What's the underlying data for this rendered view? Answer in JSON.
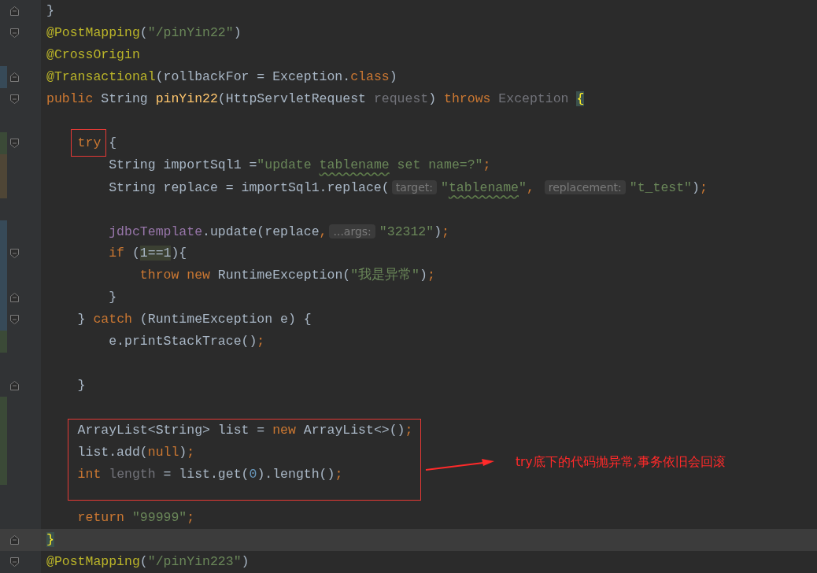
{
  "editor": {
    "lines": [
      {
        "kind": "fold-end",
        "current": false,
        "tokens": [
          {
            "kind": "plain",
            "text": "}"
          }
        ]
      },
      {
        "kind": "fold-start",
        "current": false,
        "tokens": [
          {
            "kind": "annotation",
            "text": "@PostMapping"
          },
          {
            "kind": "plain",
            "text": "("
          },
          {
            "kind": "string",
            "text": "\"/pinYin22\""
          },
          {
            "kind": "plain",
            "text": ")"
          }
        ]
      },
      {
        "kind": "code",
        "current": false,
        "tokens": [
          {
            "kind": "annotation",
            "text": "@CrossOrigin"
          }
        ]
      },
      {
        "kind": "fold-end",
        "color": "#374a58",
        "current": false,
        "tokens": [
          {
            "kind": "annotation",
            "text": "@Transactional"
          },
          {
            "kind": "plain",
            "text": "(rollbackFor = Exception."
          },
          {
            "kind": "keyword",
            "text": "class"
          },
          {
            "kind": "plain",
            "text": ")"
          }
        ]
      },
      {
        "kind": "fold-start",
        "current": false,
        "tokens": [
          {
            "kind": "keyword",
            "text": "public"
          },
          {
            "kind": "plain",
            "text": " String "
          },
          {
            "kind": "method",
            "text": "pinYin22"
          },
          {
            "kind": "plain",
            "text": "(HttpServletRequest "
          },
          {
            "kind": "unused",
            "text": "request"
          },
          {
            "kind": "plain",
            "text": ") "
          },
          {
            "kind": "keyword",
            "text": "throws"
          },
          {
            "kind": "unused",
            "text": " Exception "
          },
          {
            "kind": "brace-match",
            "text": "{"
          }
        ]
      },
      {
        "kind": "code",
        "current": false
      },
      {
        "kind": "fold-start",
        "color": "#3b4a37",
        "current": false,
        "tokens": [
          {
            "kind": "marked-keyword",
            "text": "    try"
          },
          {
            "kind": "plain",
            "text": " {"
          }
        ]
      },
      {
        "kind": "code",
        "color": "#4f4636",
        "current": false,
        "tokens": [
          {
            "kind": "plain",
            "text": "        String importSql1 ="
          },
          {
            "kind": "string",
            "text": "\"update "
          },
          {
            "kind": "typo",
            "text": "tablename"
          },
          {
            "kind": "string",
            "text": " set name=?\""
          },
          {
            "kind": "keyword",
            "text": ";"
          }
        ]
      },
      {
        "kind": "code",
        "color": "#4f4636",
        "current": false,
        "tokens": [
          {
            "kind": "plain",
            "text": "        String replace = importSql1.replace("
          },
          {
            "kind": "hint",
            "text": "target:"
          },
          {
            "kind": "string",
            "text": "\""
          },
          {
            "kind": "typo",
            "text": "tablename"
          },
          {
            "kind": "string",
            "text": "\""
          },
          {
            "kind": "keyword",
            "text": ", "
          },
          {
            "kind": "hint",
            "text": "replacement:"
          },
          {
            "kind": "string",
            "text": "\"t_test\""
          },
          {
            "kind": "plain",
            "text": ")"
          },
          {
            "kind": "keyword",
            "text": ";"
          }
        ]
      },
      {
        "kind": "code",
        "current": false
      },
      {
        "kind": "code",
        "color": "#374a58",
        "current": false,
        "tokens": [
          {
            "kind": "field",
            "text": "        jdbcTemplate"
          },
          {
            "kind": "plain",
            "text": ".update(replace"
          },
          {
            "kind": "keyword",
            "text": ","
          },
          {
            "kind": "hint",
            "text": "...args:"
          },
          {
            "kind": "string",
            "text": "\"32312\""
          },
          {
            "kind": "plain",
            "text": ")"
          },
          {
            "kind": "keyword",
            "text": ";"
          }
        ]
      },
      {
        "kind": "fold-start",
        "color": "#374a58",
        "current": false,
        "tokens": [
          {
            "kind": "keyword",
            "text": "        if"
          },
          {
            "kind": "plain",
            "text": " ("
          },
          {
            "kind": "highlight",
            "text": "1==1"
          },
          {
            "kind": "plain",
            "text": "){"
          }
        ]
      },
      {
        "kind": "code",
        "color": "#374a58",
        "current": false,
        "tokens": [
          {
            "kind": "keyword",
            "text": "            throw new"
          },
          {
            "kind": "plain",
            "text": " RuntimeException("
          },
          {
            "kind": "string",
            "text": "\"我是异常\""
          },
          {
            "kind": "plain",
            "text": ")"
          },
          {
            "kind": "keyword",
            "text": ";"
          }
        ]
      },
      {
        "kind": "fold-end",
        "color": "#374a58",
        "current": false,
        "tokens": [
          {
            "kind": "plain",
            "text": "        }"
          }
        ]
      },
      {
        "kind": "fold-start",
        "color": "#374a58",
        "current": false,
        "tokens": [
          {
            "kind": "plain",
            "text": "    } "
          },
          {
            "kind": "keyword",
            "text": "catch"
          },
          {
            "kind": "plain",
            "text": " (RuntimeException e) {"
          }
        ]
      },
      {
        "kind": "code",
        "color": "#3b4a37",
        "current": false,
        "tokens": [
          {
            "kind": "plain",
            "text": "        e.printStackTrace()"
          },
          {
            "kind": "keyword",
            "text": ";"
          }
        ]
      },
      {
        "kind": "code",
        "current": false
      },
      {
        "kind": "fold-end",
        "current": false,
        "tokens": [
          {
            "kind": "plain",
            "text": "    }"
          }
        ]
      },
      {
        "kind": "code",
        "color": "#3b4a37",
        "current": false
      },
      {
        "kind": "framed-block",
        "note": "try底下的代码抛异常,事务依旧会回滚",
        "lines": [
          {
            "kind": "code",
            "color": "#3b4a37",
            "current": false,
            "tokens": [
              {
                "kind": "plain",
                "text": "    ArrayList<String> list = "
              },
              {
                "kind": "keyword",
                "text": "new"
              },
              {
                "kind": "plain",
                "text": " ArrayList<>()"
              },
              {
                "kind": "keyword",
                "text": ";"
              }
            ]
          },
          {
            "kind": "code",
            "color": "#3b4a37",
            "current": false,
            "tokens": [
              {
                "kind": "plain",
                "text": "    list.add("
              },
              {
                "kind": "keyword",
                "text": "null"
              },
              {
                "kind": "plain",
                "text": ")"
              },
              {
                "kind": "keyword",
                "text": ";"
              }
            ]
          },
          {
            "kind": "code",
            "color": "#3b4a37",
            "current": false,
            "tokens": [
              {
                "kind": "keyword",
                "text": "    int"
              },
              {
                "kind": "unused",
                "text": " length"
              },
              {
                "kind": "plain",
                "text": " = list.get("
              },
              {
                "kind": "number",
                "text": "0"
              },
              {
                "kind": "plain",
                "text": ").length()"
              },
              {
                "kind": "keyword",
                "text": ";"
              }
            ]
          },
          {
            "kind": "code",
            "current": false
          }
        ]
      },
      {
        "kind": "code",
        "current": false,
        "tokens": [
          {
            "kind": "keyword",
            "text": "    return"
          },
          {
            "kind": "string",
            "text": " \"99999\""
          },
          {
            "kind": "keyword",
            "text": ";"
          }
        ]
      },
      {
        "kind": "fold-end",
        "current": true,
        "tokens": [
          {
            "kind": "brace-match",
            "text": "}"
          }
        ]
      },
      {
        "kind": "fold-start",
        "current": false,
        "tokens": [
          {
            "kind": "annotation",
            "text": "@PostMapping"
          },
          {
            "kind": "plain",
            "text": "("
          },
          {
            "kind": "string",
            "text": "\"/pinYin223\""
          },
          {
            "kind": "plain",
            "text": ")"
          }
        ]
      }
    ]
  }
}
